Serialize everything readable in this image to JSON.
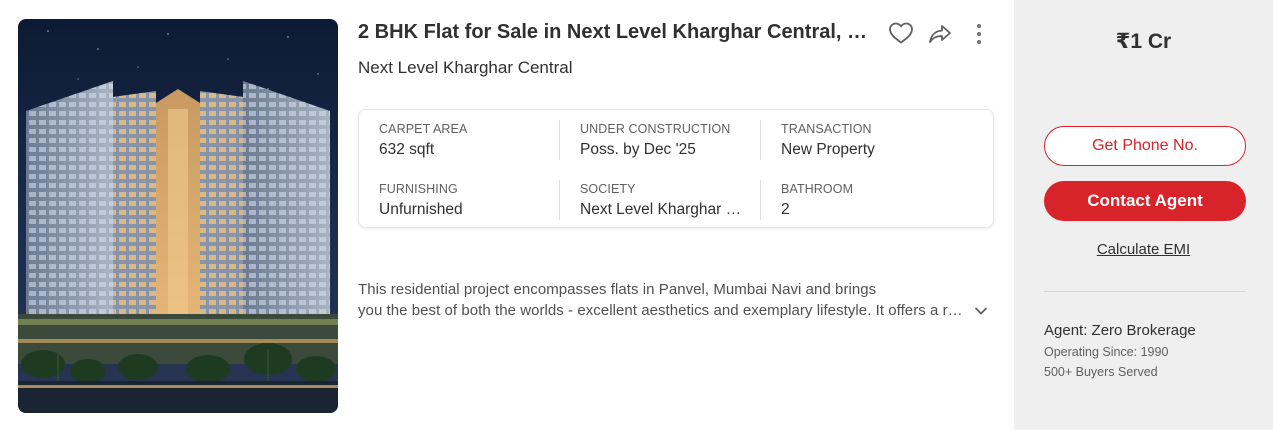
{
  "listing": {
    "title": "2 BHK Flat for Sale in Next Level Kharghar Central, Kharghar, Navi Mumbai",
    "project_name": "Next Level Kharghar Central",
    "image_alt": "Next Level Kharghar Central building exterior at night"
  },
  "actions": {
    "shortlist_icon": "heart-outline-icon",
    "share_icon": "share-arrow-icon",
    "more_icon": "vertical-dots-icon"
  },
  "summary": [
    {
      "label": "CARPET AREA",
      "value": "632 sqft"
    },
    {
      "label": "UNDER CONSTRUCTION",
      "value": "Poss. by Dec '25"
    },
    {
      "label": "TRANSACTION",
      "value": "New Property"
    },
    {
      "label": "FURNISHING",
      "value": "Unfurnished"
    },
    {
      "label": "SOCIETY",
      "value": "Next Level Kharghar Central"
    },
    {
      "label": "BATHROOM",
      "value": "2"
    }
  ],
  "description": {
    "line1": "This residential project encompasses flats in Panvel, Mumbai Navi and brings",
    "line2": "you the best of both the worlds - excellent aesthetics and exemplary lifestyle. It offers a range of amenities"
  },
  "pricing": {
    "price": "₹1 Cr"
  },
  "cta": {
    "phone_label": "Get Phone No.",
    "contact_label": "Contact Agent",
    "emi_label": "Calculate EMI"
  },
  "agent": {
    "name_line": "Agent: Zero Brokerage",
    "operating_since": "Operating Since: 1990",
    "buyers_served": "500+ Buyers Served"
  },
  "colors": {
    "brand_red": "#d8232a",
    "side_panel_bg": "#efefef"
  }
}
